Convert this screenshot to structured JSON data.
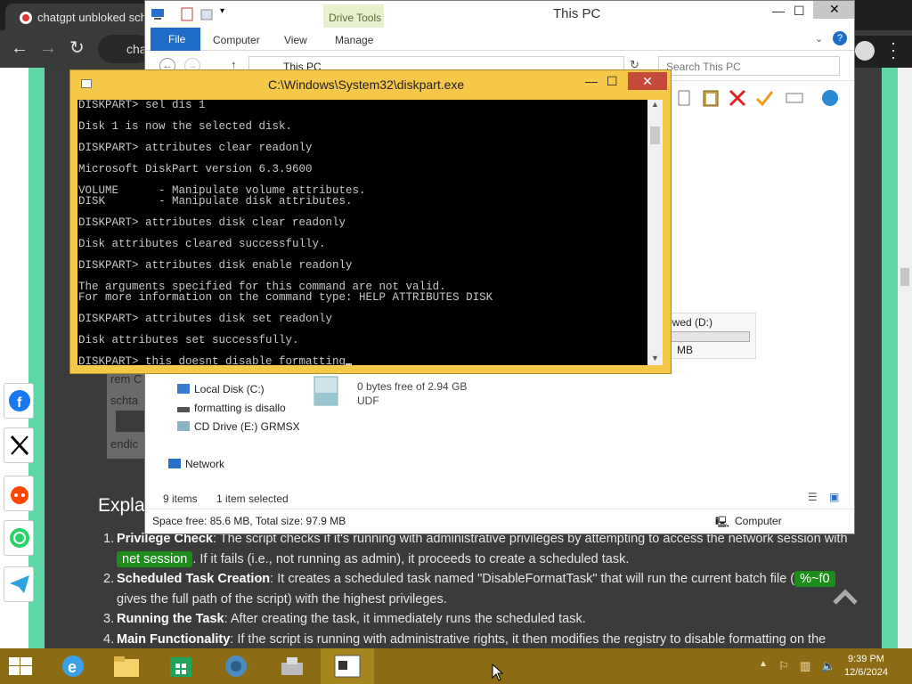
{
  "browser": {
    "tab_title": "chatgpt unbloked scho",
    "omnibox_text": "chat"
  },
  "page": {
    "code_fragments": [
      "rem C",
      "schta",
      "endic"
    ],
    "heading": "Expla",
    "items": [
      {
        "num": "1.",
        "title": "Privilege Check",
        "pre": ": The script checks if it's running with administrative privileges by attempting to access the network session with ",
        "code": "net session",
        "post": ". If it fails (i.e., not running as admin), it proceeds to create a scheduled task."
      },
      {
        "num": "2.",
        "title": "Scheduled Task Creation",
        "pre": ": It creates a scheduled task named \"DisableFormatTask\" that will run the current batch file (",
        "code": "%~f0",
        "post": " gives the full path of the script) with the highest privileges."
      },
      {
        "num": "3.",
        "title": "Running the Task",
        "pre": ": After creating the task, it immediately runs the scheduled task.",
        "code": "",
        "post": ""
      },
      {
        "num": "4.",
        "title": "Main Functionality",
        "pre": ": If the script is running with administrative rights, it then modifies the registry to disable formatting on the",
        "code": "",
        "post": ""
      }
    ],
    "share_icons": [
      "facebook-icon",
      "x-icon",
      "reddit-icon",
      "whatsapp-icon",
      "telegram-icon"
    ]
  },
  "explorer": {
    "title": "This PC",
    "drive_tools": "Drive Tools",
    "ribbon_tabs": [
      "File",
      "Computer",
      "View",
      "Manage"
    ],
    "address": "This PC",
    "search_placeholder": "Search This PC",
    "drive_tile_label": "owed (D:)",
    "drive_tile_size": "MB",
    "drive_fill": 0.0,
    "udf_free": "0 bytes free of 2.94 GB",
    "udf_fs": "UDF",
    "nav": [
      "Local Disk (C:)",
      "formatting is disallo",
      "CD Drive (E:) GRMSX",
      "Network"
    ],
    "items_count": "9 items",
    "selected": "1 item selected",
    "space": "Space free: 85.6 MB, Total size: 97.9 MB",
    "location": "Computer"
  },
  "console": {
    "title": "C:\\Windows\\System32\\diskpart.exe",
    "lines": [
      "DISKPART> sel dis 1",
      "",
      "Disk 1 is now the selected disk.",
      "",
      "DISKPART> attributes clear readonly",
      "",
      "Microsoft DiskPart version 6.3.9600",
      "",
      "VOLUME      - Manipulate volume attributes.",
      "DISK        - Manipulate disk attributes.",
      "",
      "DISKPART> attributes disk clear readonly",
      "",
      "Disk attributes cleared successfully.",
      "",
      "DISKPART> attributes disk enable readonly",
      "",
      "The arguments specified for this command are not valid.",
      "For more information on the command type: HELP ATTRIBUTES DISK",
      "",
      "DISKPART> attributes disk set readonly",
      "",
      "Disk attributes set successfully.",
      "",
      "DISKPART> this doesnt disable formatting"
    ]
  },
  "taskbar": {
    "time": "9:39 PM",
    "date": "12/6/2024"
  }
}
